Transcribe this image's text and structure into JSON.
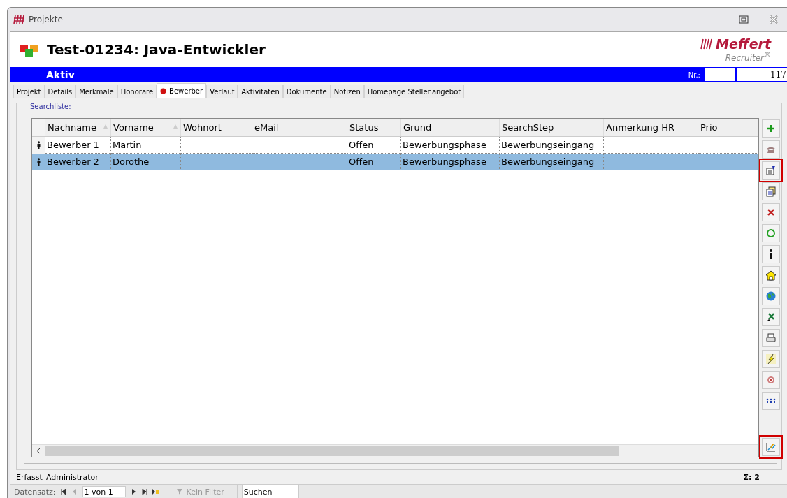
{
  "window": {
    "title": "Projekte"
  },
  "header": {
    "title": "Test-01234: Java-Entwickler",
    "logo_name": "Meffert",
    "logo_sub": "Recruiter",
    "logo_mark": "®"
  },
  "status_bar": {
    "status": "Aktiv",
    "nr_label": "Nr.:",
    "nr_value": "117"
  },
  "tabs": [
    {
      "label": "Projekt",
      "selected": false
    },
    {
      "label": "Details",
      "selected": false
    },
    {
      "label": "Merkmale",
      "selected": false
    },
    {
      "label": "Honorare",
      "selected": false
    },
    {
      "label": "Bewerber",
      "selected": true
    },
    {
      "label": "Verlauf",
      "selected": false
    },
    {
      "label": "Aktivitäten",
      "selected": false
    },
    {
      "label": "Dokumente",
      "selected": false
    },
    {
      "label": "Notizen",
      "selected": false
    },
    {
      "label": "Homepage Stellenangebot",
      "selected": false
    }
  ],
  "group": {
    "legend": "Searchliste:"
  },
  "table": {
    "columns": [
      {
        "label": "Nachname",
        "sorted": true
      },
      {
        "label": "Vorname",
        "sorted": true
      },
      {
        "label": "Wohnort",
        "sorted": false
      },
      {
        "label": "eMail",
        "sorted": false
      },
      {
        "label": "Status",
        "sorted": false
      },
      {
        "label": "Grund",
        "sorted": false
      },
      {
        "label": "SearchStep",
        "sorted": false
      },
      {
        "label": "Anmerkung HR",
        "sorted": false
      },
      {
        "label": "Prio",
        "sorted": false
      }
    ],
    "rows": [
      {
        "selected": false,
        "cells": [
          "Bewerber 1",
          "Martin",
          "",
          "",
          "Offen",
          "Bewerbungsphase",
          "Bewerbungseingang",
          "",
          ""
        ]
      },
      {
        "selected": true,
        "cells": [
          "Bewerber 2",
          "Dorothe",
          "",
          "",
          "Offen",
          "Bewerbungsphase",
          "Bewerbungseingang",
          "",
          ""
        ]
      }
    ]
  },
  "side_buttons": [
    {
      "kind": "add",
      "highlighted": false
    },
    {
      "kind": "phone",
      "highlighted": false
    },
    {
      "kind": "edit",
      "highlighted": true
    },
    {
      "kind": "copy",
      "highlighted": false
    },
    {
      "kind": "delete",
      "highlighted": false
    },
    {
      "kind": "refresh",
      "highlighted": false
    },
    {
      "kind": "person",
      "highlighted": false
    },
    {
      "kind": "house",
      "highlighted": false
    },
    {
      "kind": "globe",
      "highlighted": false
    },
    {
      "kind": "excel",
      "highlighted": false
    },
    {
      "kind": "print",
      "highlighted": false
    },
    {
      "kind": "flash",
      "highlighted": false
    },
    {
      "kind": "target",
      "highlighted": false
    },
    {
      "kind": "people",
      "highlighted": false
    }
  ],
  "corner_button": {
    "kind": "chart",
    "highlighted": true
  },
  "footer": {
    "created_label": "Erfasst",
    "created_by": "Administrator",
    "sum": "Σ: 2"
  },
  "navigator": {
    "label": "Datensatz:",
    "record": "1 von 1",
    "filter": "Kein Filter",
    "search": "Suchen"
  }
}
